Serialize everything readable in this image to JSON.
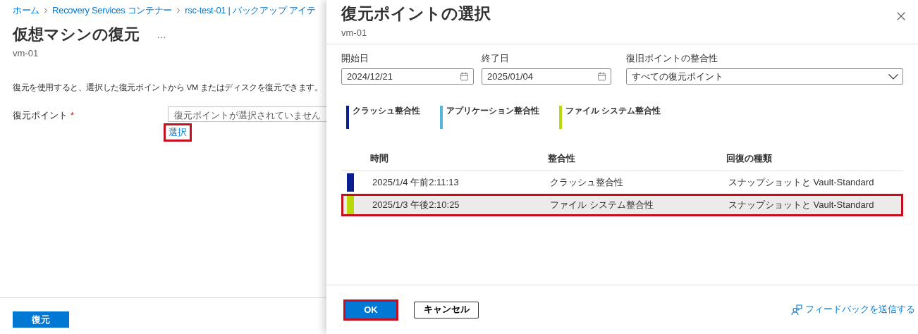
{
  "page": {
    "breadcrumb": [
      "ホーム",
      "Recovery Services コンテナー",
      "rsc-test-01 | バックアップ アイテ"
    ],
    "title": "仮想マシンの復元",
    "more": "…",
    "subtitle": "vm-01",
    "description": "復元を使用すると、選択した復元ポイントから VM またはディスクを復元できます。",
    "restore_point": {
      "label": "復元ポイント",
      "required_mark": "*",
      "placeholder": "復元ポイントが選択されていません",
      "link": "選択",
      "link_highlighted": true
    },
    "restore_button": "復元"
  },
  "panel": {
    "title": "復元ポイントの選択",
    "subtitle": "vm-01",
    "filters": [
      {
        "kind": "date",
        "label": "開始日",
        "value": "2024/12/21"
      },
      {
        "kind": "date",
        "label": "終了日",
        "value": "2025/01/04"
      },
      {
        "kind": "select",
        "label": "復旧ポイントの整合性",
        "value": "すべての復元ポイント"
      }
    ],
    "legend": [
      {
        "label": "クラッシュ整合性",
        "color": "#0b1d8f"
      },
      {
        "label": "アプリケーション整合性",
        "color": "#59b4d9"
      },
      {
        "label": "ファイル システム整合性",
        "color": "#bad80a"
      }
    ],
    "table": {
      "columns": [
        "時間",
        "整合性",
        "回復の種類"
      ],
      "rows": [
        {
          "color": "#0b1d8f",
          "selected": false,
          "highlighted": false,
          "cells": [
            "2025/1/4 午前2:11:13",
            "クラッシュ整合性",
            "スナップショットと Vault-Standard"
          ]
        },
        {
          "color": "#bad80a",
          "selected": true,
          "highlighted": true,
          "cells": [
            "2025/1/3 午後2:10:25",
            "ファイル システム整合性",
            "スナップショットと Vault-Standard"
          ]
        }
      ]
    },
    "ok": {
      "label": "OK",
      "highlighted": true
    },
    "cancel": "キャンセル",
    "feedback": "フィードバックを送信する"
  }
}
